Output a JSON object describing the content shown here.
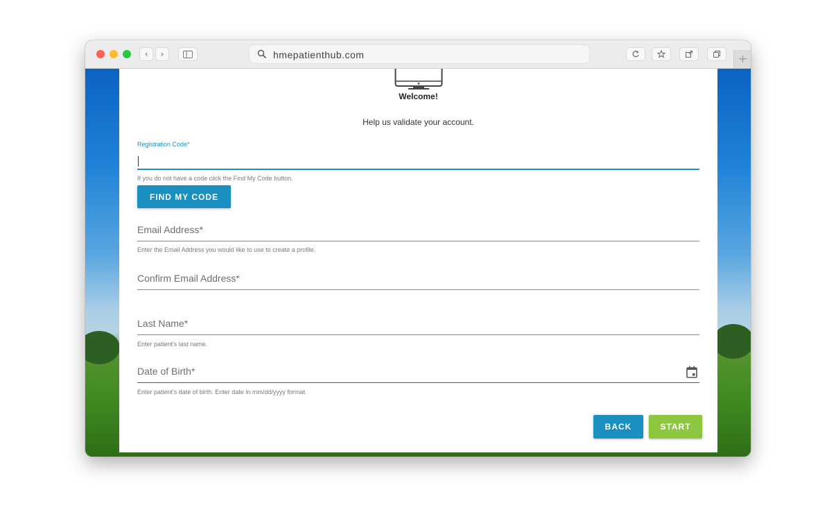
{
  "browser": {
    "url": "hmepatienthub.com",
    "new_tab_label": "+",
    "back_glyph": "‹",
    "forward_glyph": "›"
  },
  "icons": [
    "monitor-icon",
    "search-icon",
    "sidebar-icon",
    "reload-icon",
    "star-icon",
    "share-icon",
    "tabs-icon",
    "calendar-icon"
  ],
  "form": {
    "welcome": "Welcome!",
    "subtitle": "Help us validate your account.",
    "registration_code": {
      "label": "Registration Code*",
      "value": "",
      "hint": "If you do not have a code click the Find My Code button."
    },
    "find_code_button": "FIND MY CODE",
    "email": {
      "placeholder": "Email Address*",
      "hint": "Enter the Email Address you would like to use to create a profile."
    },
    "confirm_email": {
      "placeholder": "Confirm Email Address*"
    },
    "last_name": {
      "placeholder": "Last Name*",
      "hint": "Enter patient's last name."
    },
    "dob": {
      "placeholder": "Date of Birth*",
      "hint": "Enter patient's date of birth. Enter date in mm/dd/yyyy format."
    },
    "back_button": "BACK",
    "start_button": "START"
  },
  "colors": {
    "primary": "#1a8fc0",
    "start": "#8dc63f",
    "text_muted": "#7a7a7a"
  }
}
